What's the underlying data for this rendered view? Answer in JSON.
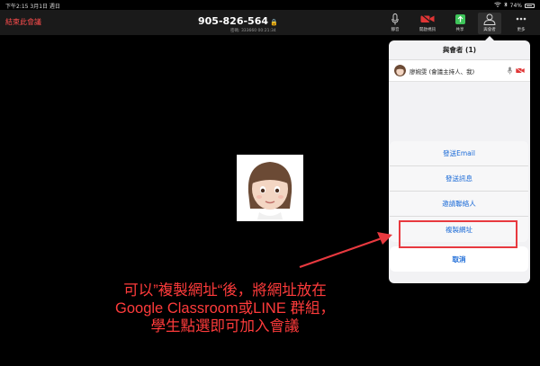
{
  "status": {
    "time_date": "下午2:15  3月1日 週日",
    "battery": "74%"
  },
  "toolbar": {
    "end_meeting": "結束此會議",
    "meeting_id": "905-826-564",
    "meeting_sub": "密碼: 333660  00:21:34",
    "buttons": [
      {
        "label": "靜音",
        "icon": "microphone-icon"
      },
      {
        "label": "開啟視訊",
        "icon": "video-off-icon"
      },
      {
        "label": "共享",
        "icon": "share-icon"
      },
      {
        "label": "與會者",
        "icon": "participants-icon"
      },
      {
        "label": "更多",
        "icon": "more-icon"
      }
    ]
  },
  "panel": {
    "title": "與會者 (1)",
    "participant_name": "廖婉雯 (會議主持人、我)"
  },
  "sheet": {
    "items": [
      "發送Email",
      "發送訊息",
      "邀請聯絡人",
      "複製網址"
    ],
    "cancel": "取消"
  },
  "caption": {
    "line1": "可以”複製網址“後，將網址放在",
    "line2": "Google Classroom或LINE 群組，",
    "line3": "學生點選即可加入會議"
  },
  "colors": {
    "annotation_red": "#e8393f",
    "link_blue": "#1a6ad7",
    "end_red": "#ff4d4d",
    "share_green": "#3ec45a"
  }
}
